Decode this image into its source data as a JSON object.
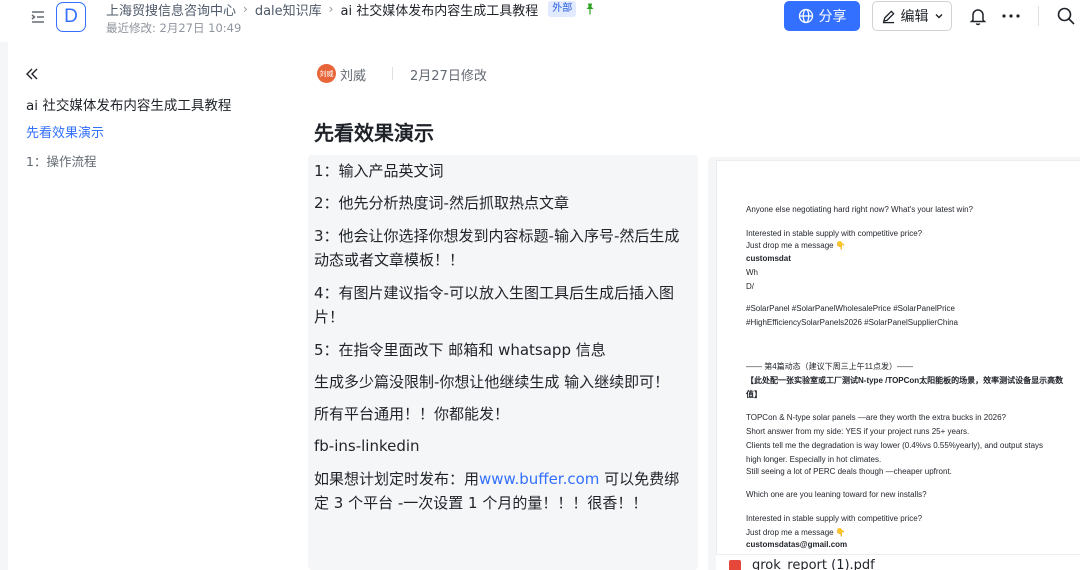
{
  "header": {
    "logo_letter": "D",
    "breadcrumbs": [
      "上海贸搜信息咨询中心",
      "dale知识库",
      "ai 社交媒体发布内容生成工具教程"
    ],
    "badge": "外部",
    "last_modified": "最近修改: 2月27日 10:49",
    "share_label": "分享",
    "edit_label": "编辑",
    "icons": {
      "collapse": "sidebar-toggle-icon",
      "pin": "pin-icon",
      "share": "globe-icon",
      "edit": "pencil-icon",
      "bell": "bell-icon",
      "more": "more-icon",
      "search": "search-icon"
    },
    "colors": {
      "accent": "#3370ff",
      "badge_bg": "#e1eaff",
      "pin": "#2ea121"
    }
  },
  "outline": {
    "title": "ai 社交媒体发布内容生成工具教程",
    "items": [
      {
        "label": "先看效果演示",
        "active": true
      },
      {
        "label": "1：操作流程",
        "active": false
      }
    ]
  },
  "doc": {
    "author_avatar": "刘威",
    "author": "刘威",
    "modified": "2月27日修改",
    "heading": "先看效果演示",
    "paragraphs": [
      "1：输入产品英文词",
      "2：他先分析热度词-然后抓取热点文章",
      "3：他会让你选择你想发到内容标题-输入序号-然后生成动态或者文章模板！！",
      "4：有图片建议指令-可以放入生图工具后生成后插入图片！",
      "5：在指令里面改下 邮箱和 whatsapp 信息",
      "生成多少篇没限制-你想让他继续生成 输入继续即可！",
      "所有平台通用！！你都能发！",
      "fb-ins-linkedin"
    ],
    "last_para": {
      "before": "如果想计划定时发布：用",
      "link": "www.buffer.com",
      "after": " 可以免费绑定 3 个平台 -一次设置 1 个月的量！！！很香！！"
    }
  },
  "image_preview": {
    "lines": [
      {
        "text": "Anyone else negotiating hard right now? What's your latest win?"
      },
      {
        "text": "Interested in stable supply with competitive price?"
      },
      {
        "text": "Just drop me a message 👇"
      },
      {
        "text": "customsdat",
        "bold": true
      },
      {
        "text": "Wh"
      },
      {
        "text": "D/"
      },
      {
        "text": "#SolarPanel #SolarPanelWholesalePrice #SolarPanelPrice"
      },
      {
        "text": "#HighEfficiencySolarPanels2026 #SolarPanelSupplierChina"
      },
      {
        "text": "—— 第4篇动态（建议下周三上午11点发）——"
      },
      {
        "text": "【此处配一张实验室或工厂测试N-type /TOPCon太阳能板的场景，效率测试设备显示高数",
        "bold": true
      },
      {
        "text": "值】",
        "bold": true
      },
      {
        "text": "TOPCon & N-type solar panels —are they worth the extra bucks in 2026?"
      },
      {
        "text": "Short answer from my side: YES if your project runs 25+ years."
      },
      {
        "text": "Clients tell me the degradation is way lower (0.4%vs 0.55%yearly), and output stays"
      },
      {
        "text": "high longer. Especially in hot climates."
      },
      {
        "text": "Still seeing a lot of PERC deals though —cheaper upfront."
      },
      {
        "text": "Which one are you leaning toward for new installs?"
      },
      {
        "text": "Interested in stable supply with competitive price?"
      },
      {
        "text": "Just drop me a message 👇"
      },
      {
        "text": "customsdatas@gmail.com",
        "bold": true
      }
    ],
    "attachment": "grok_report (1).pdf"
  }
}
